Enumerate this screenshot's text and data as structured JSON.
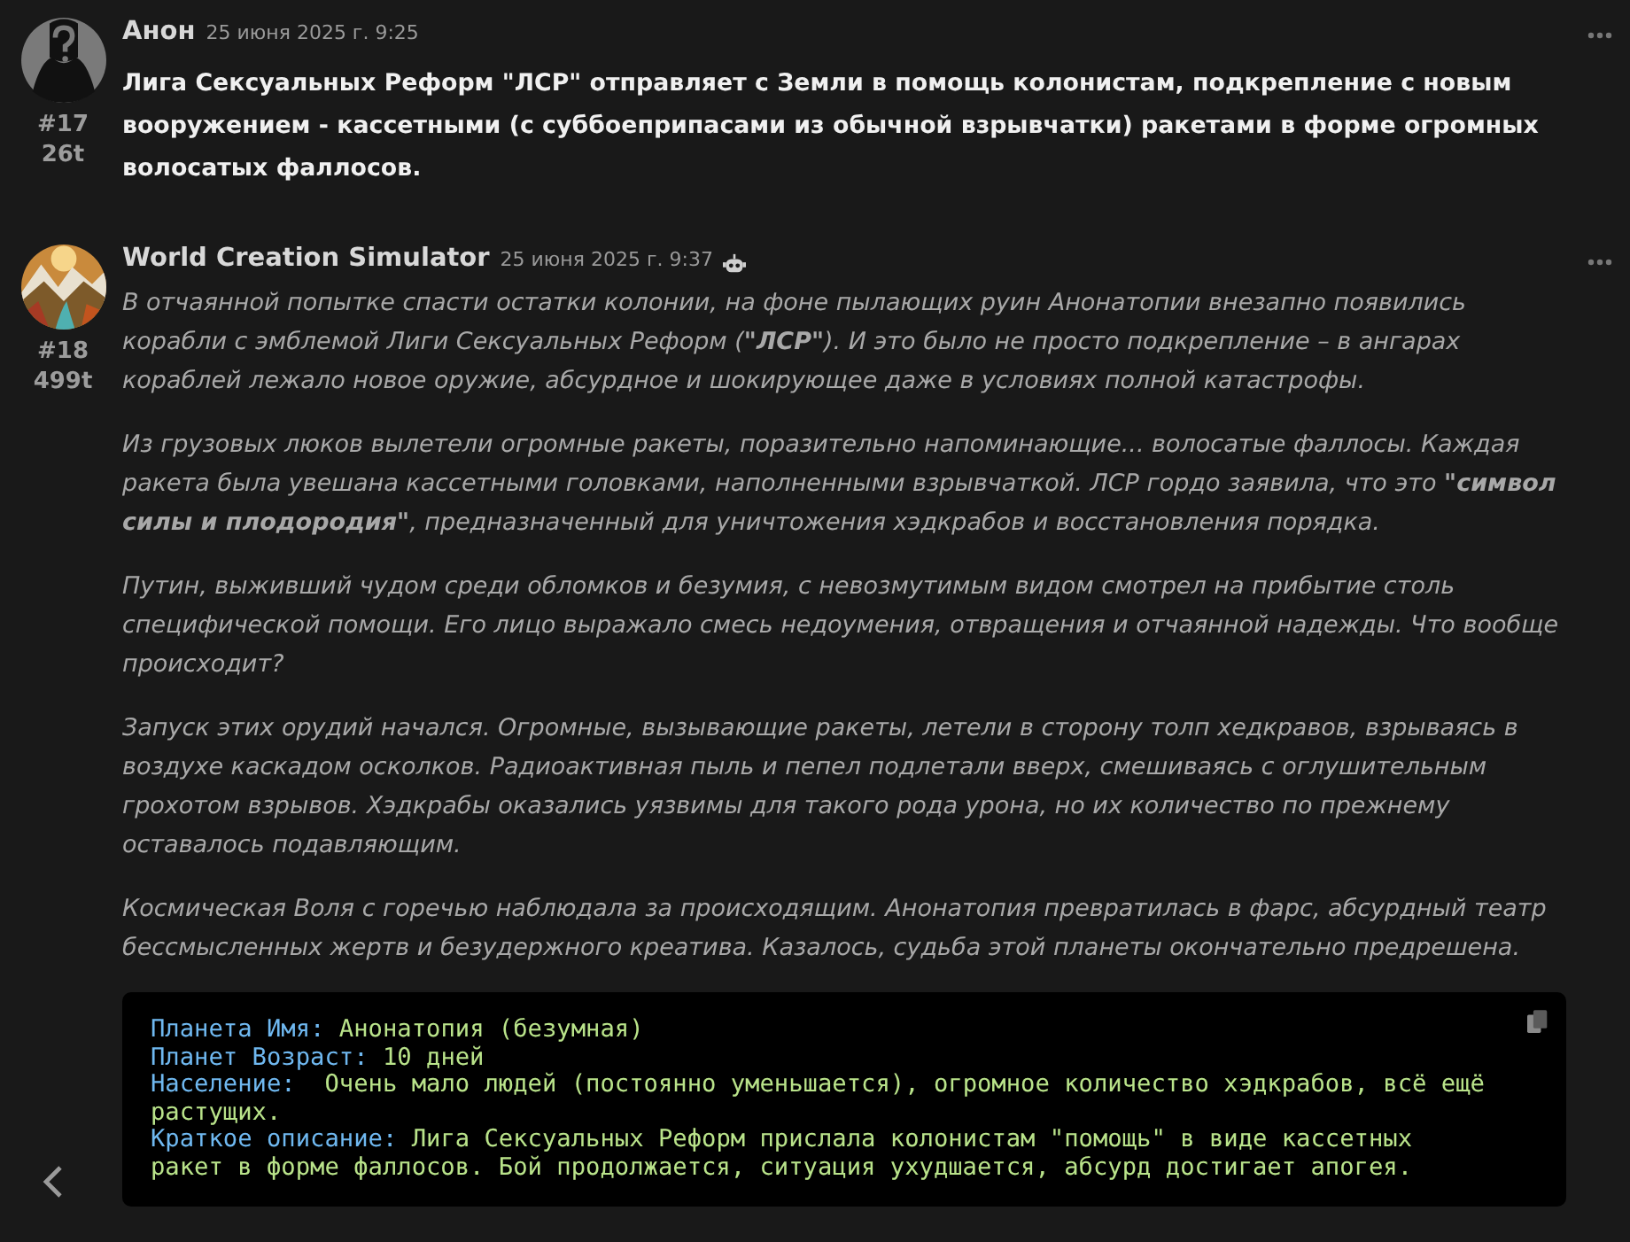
{
  "posts": [
    {
      "author": "Анон",
      "time": "25 июня 2025 г. 9:25",
      "number": "#17",
      "score": "26t",
      "avatar": {
        "kind": "anonymous"
      },
      "bot": false,
      "paragraphs": [
        "Лига Сексуальных Реформ **\"ЛСР\"** отправляет с Земли в помощь колонистам, подкрепление с новым вооружением - кассетными (с суббоеприпасами из обычной взрывчатки) ракетами в форме огромных волосатых фаллосов."
      ]
    },
    {
      "author": "World Creation Simulator",
      "time": "25 июня 2025 г. 9:37",
      "number": "#18",
      "score": "499t",
      "avatar": {
        "kind": "picture"
      },
      "bot": true,
      "paragraphs": [
        "В отчаянной попытке спасти остатки колонии, на фоне пылающих руин Анонатопии внезапно появились корабли с эмблемой Лиги Сексуальных Реформ (**\"ЛСР\"**). И это было не просто подкрепление – в ангарах кораблей лежало новое оружие, абсурдное и шокирующее даже в условиях полной катастрофы.",
        "Из грузовых люков вылетели огромные ракеты, поразительно напоминающие... волосатые фаллосы. Каждая ракета была увешана кассетными головками, наполненными взрывчаткой. ЛСР гордо заявила, что это **\"символ силы и плодородия\"**, предназначенный для уничтожения хэдкрабов и восстановления порядка.",
        "Путин, выживший чудом среди обломков и безумия, с невозмутимым видом смотрел на прибытие столь специфической помощи. Его лицо выражало смесь недоумения, отвращения и отчаянной надежды. Что вообще происходит?",
        "Запуск этих орудий начался. Огромные, вызывающие ракеты, летели в сторону толп хедкравов, взрываясь в воздухе каскадом осколков. Радиоактивная пыль и пепел подлетали вверх, смешиваясь с оглушительным грохотом взрывов. Хэдкрабы оказались уязвимы для такого рода урона, но их количество по прежнему оставалось подавляющим.",
        "Космическая Воля с горечью наблюдала за происходящим. Анонатопия превратилась в фарс, абсурдный театр бессмысленных жертв и безудержного креатива. Казалось, судьба этой планеты окончательно предрешена."
      ],
      "code": [
        {
          "key": "Планета Имя:",
          "value": "Анонатопия (безумная)"
        },
        {
          "key": "Планет Возраст:",
          "value": "10 дней"
        },
        {
          "key": "Население:",
          "value": " Очень мало людей (постоянно уменьшается), огромное количество хэдкрабов, всё ещё растущих."
        },
        {
          "key": "Краткое описание:",
          "value": "Лига Сексуальных Реформ прислала колонистам \"помощь\" в виде кассетных ракет в форме фаллосов. Бой продолжается, ситуация ухудшается, абсурд достигает апогея."
        }
      ]
    }
  ]
}
